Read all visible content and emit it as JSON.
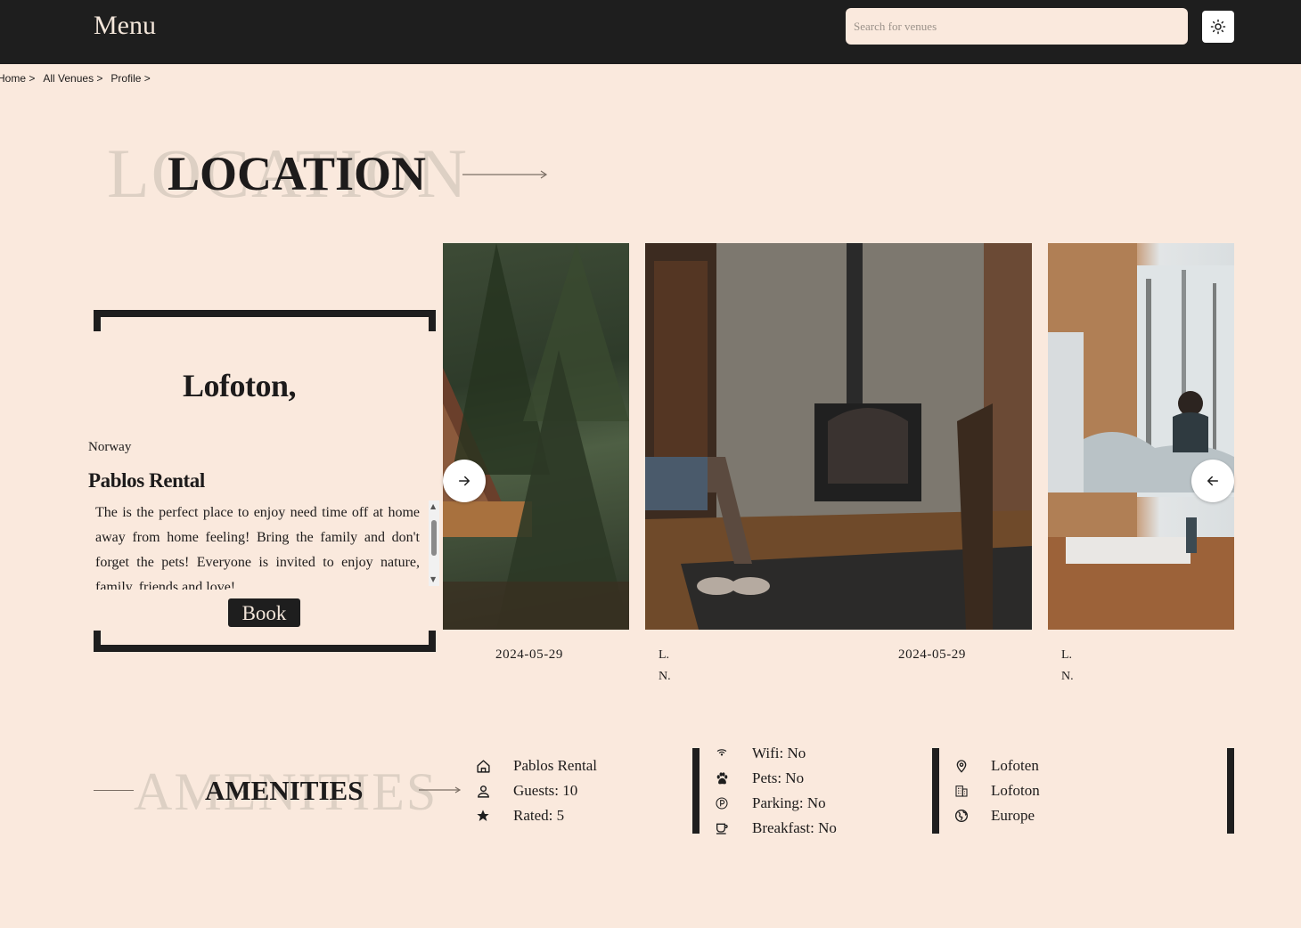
{
  "header": {
    "menu_label": "Menu",
    "search_placeholder": "Search for venues",
    "theme_icon": "sun-icon"
  },
  "breadcrumb": [
    "Home >",
    "All Venues >",
    "Profile >"
  ],
  "section_location": {
    "background_word": "LOCATION",
    "title": "LOCATION"
  },
  "venue_card": {
    "city": "Lofoton,",
    "country": "Norway",
    "name": "Pablos Rental",
    "description": "The is the perfect place to enjoy need time off at home away from home feeling! Bring the family and don't forget the pets! Everyone is invited to enjoy nature, family, friends and love!",
    "book_label": "Book"
  },
  "gallery": {
    "prev_icon": "arrow-right-icon",
    "next_icon": "arrow-left-icon",
    "captions": [
      {
        "date": "2024-05-29",
        "line1": "L.",
        "line2": "N."
      },
      {
        "date": "2024-05-29",
        "line1": "L.",
        "line2": "N."
      }
    ]
  },
  "section_amenities": {
    "background_word": "AMENITIES",
    "title": "AMENITIES"
  },
  "amenities": {
    "summary": [
      {
        "icon": "house-icon",
        "text": "Pablos Rental"
      },
      {
        "icon": "user-icon",
        "text": "Guests: 10"
      },
      {
        "icon": "star-icon",
        "text": "Rated: 5"
      }
    ],
    "features": [
      {
        "icon": "wifi-icon",
        "text": "Wifi: No"
      },
      {
        "icon": "paw-icon",
        "text": "Pets: No"
      },
      {
        "icon": "parking-icon",
        "text": "Parking: No"
      },
      {
        "icon": "coffee-icon",
        "text": "Breakfast: No"
      }
    ],
    "location": [
      {
        "icon": "map-pin-icon",
        "text": "Lofoten"
      },
      {
        "icon": "building-icon",
        "text": "Lofoton"
      },
      {
        "icon": "globe-icon",
        "text": "Europe"
      }
    ]
  }
}
